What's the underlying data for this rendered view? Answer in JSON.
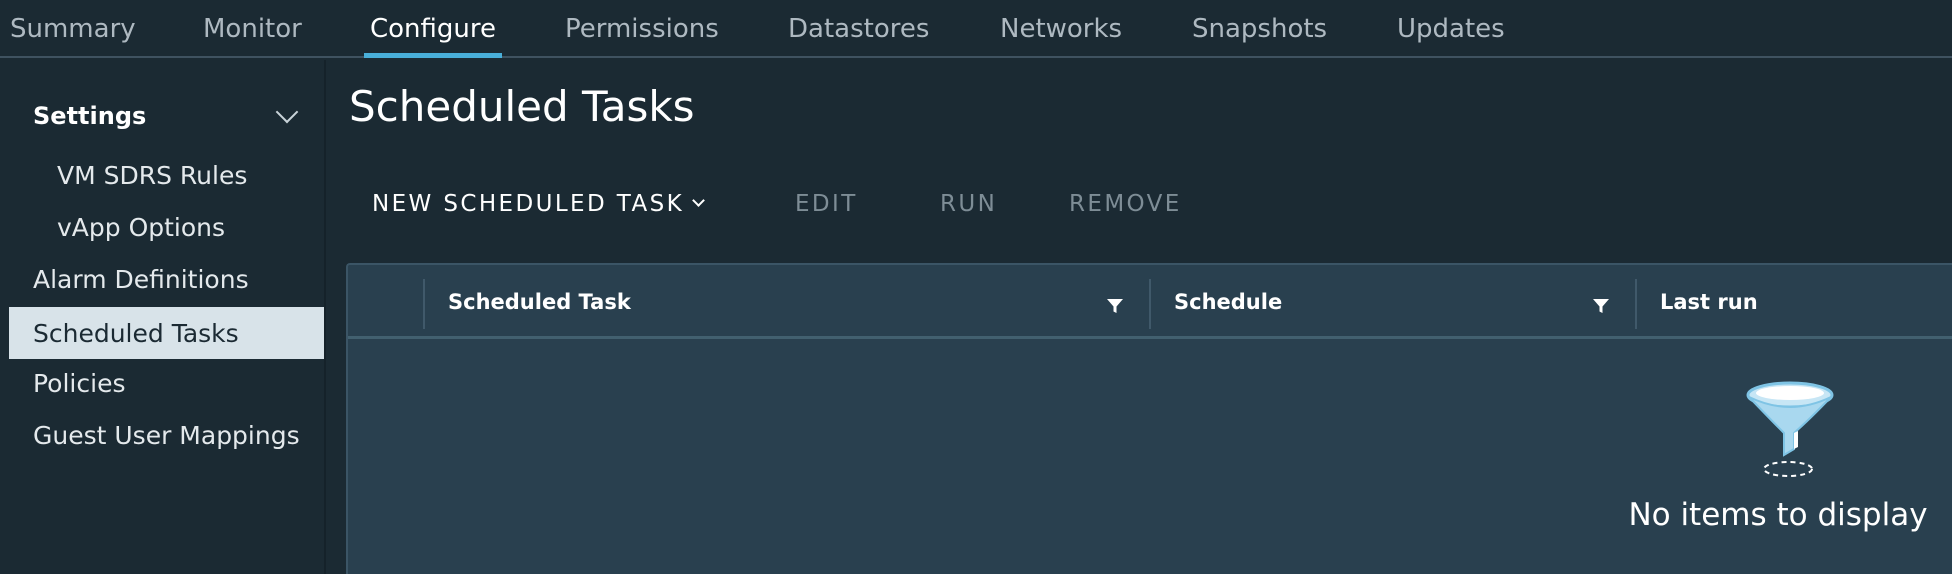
{
  "tabs": [
    {
      "label": "Summary"
    },
    {
      "label": "Monitor"
    },
    {
      "label": "Configure"
    },
    {
      "label": "Permissions"
    },
    {
      "label": "Datastores"
    },
    {
      "label": "Networks"
    },
    {
      "label": "Snapshots"
    },
    {
      "label": "Updates"
    }
  ],
  "active_tab": "Configure",
  "sidebar": {
    "group_label": "Settings",
    "items": [
      {
        "label": "VM SDRS Rules"
      },
      {
        "label": "vApp Options"
      },
      {
        "label": "Alarm Definitions"
      },
      {
        "label": "Scheduled Tasks"
      },
      {
        "label": "Policies"
      },
      {
        "label": "Guest User Mappings"
      }
    ],
    "selected": "Scheduled Tasks"
  },
  "main": {
    "title": "Scheduled Tasks",
    "toolbar": {
      "new_label": "NEW SCHEDULED TASK",
      "edit_label": "EDIT",
      "run_label": "RUN",
      "remove_label": "REMOVE"
    },
    "grid": {
      "columns": [
        {
          "label": "Scheduled Task"
        },
        {
          "label": "Schedule"
        },
        {
          "label": "Last run"
        }
      ],
      "empty_text": "No items to display"
    }
  },
  "colors": {
    "background": "#1b2a33",
    "accent": "#49afd9",
    "selected_item": "#d8e3e9",
    "grid_background": "#29404f"
  },
  "icons": {
    "sidebar_toggle": "chevron-down-icon",
    "column_filter": "filter-icon",
    "empty_state": "funnel-icon"
  }
}
